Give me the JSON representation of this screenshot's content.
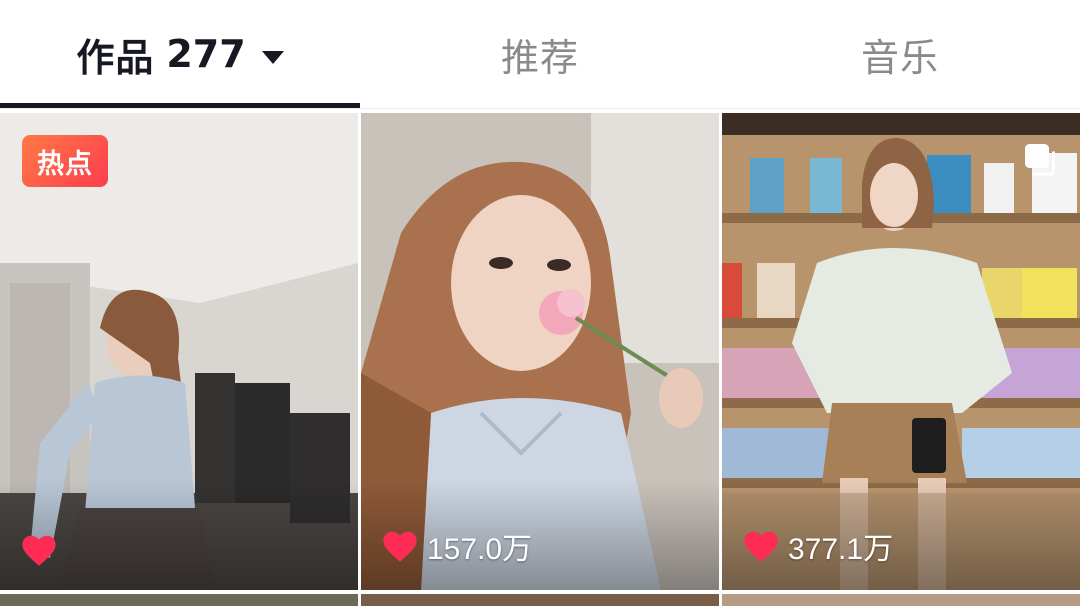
{
  "tabs": [
    {
      "label": "作品",
      "count": "277",
      "active": true
    },
    {
      "label": "推荐",
      "active": false
    },
    {
      "label": "音乐",
      "active": false
    }
  ],
  "grid": [
    {
      "badge": "热点",
      "likes": "",
      "icon": "heart-icon"
    },
    {
      "likes": "157.0万",
      "icon": "heart-icon"
    },
    {
      "likes": "377.1万",
      "icon": "heart-icon",
      "overlay_icon": "multi-image-icon"
    }
  ],
  "colors": {
    "active_text": "#161823",
    "inactive_text": "#8a8a8a",
    "heart": "#fe2c55",
    "badge_start": "#ff7a45",
    "badge_end": "#fe3c4f"
  }
}
